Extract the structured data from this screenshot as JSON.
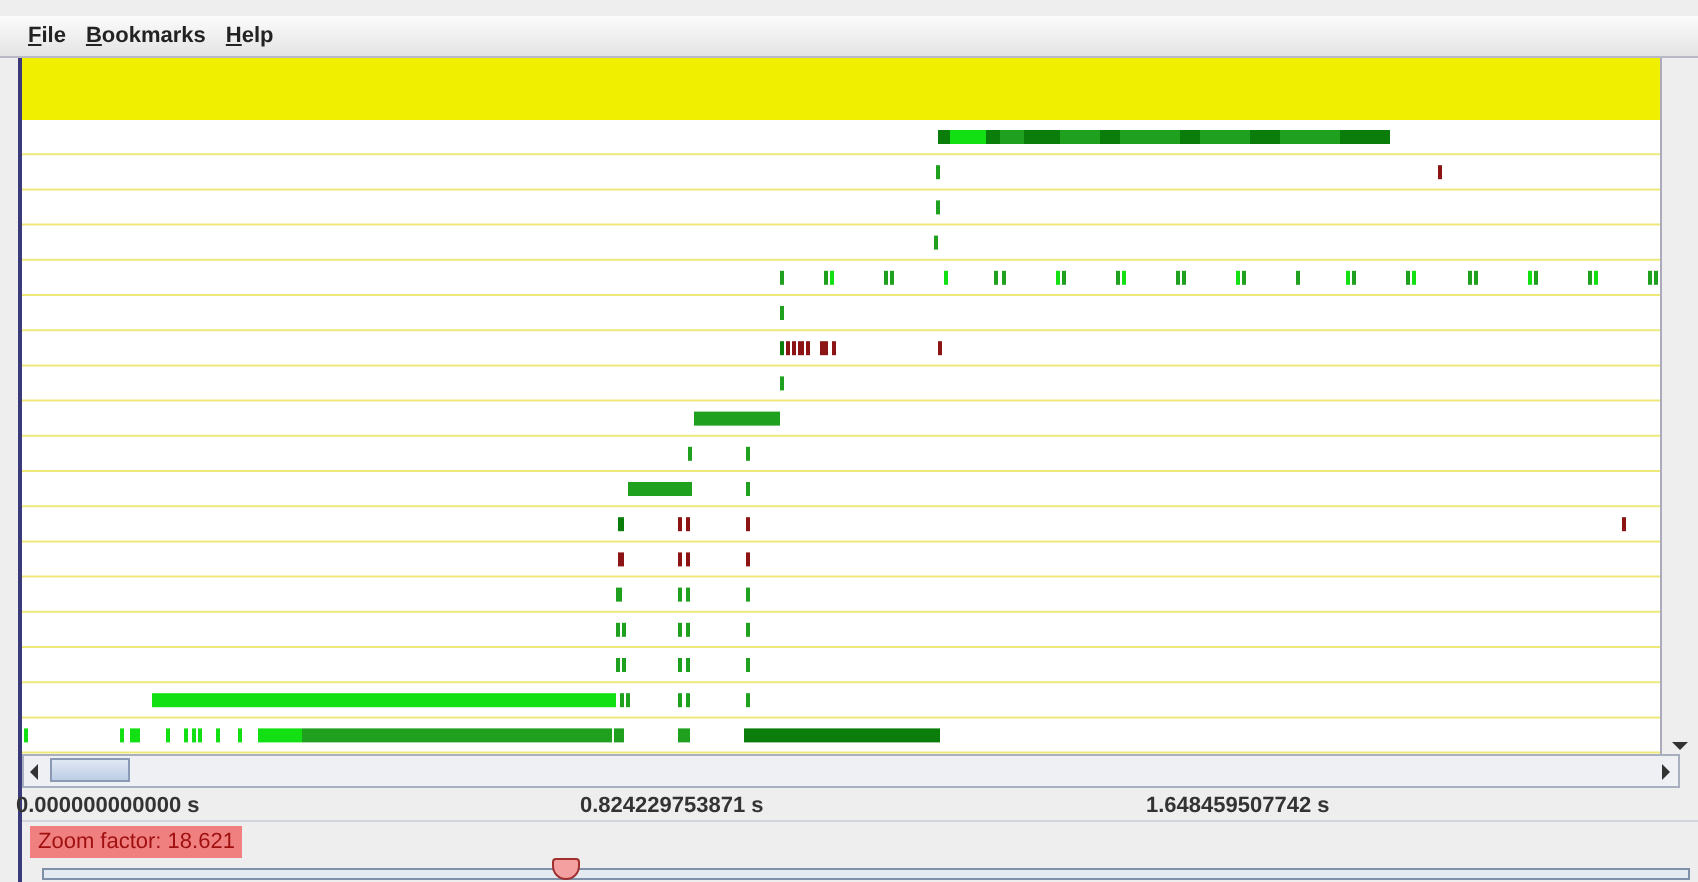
{
  "menu": [
    {
      "label": "File"
    },
    {
      "label": "Bookmarks"
    },
    {
      "label": "Help"
    }
  ],
  "axis_labels": [
    "0.000000000000 s",
    "0.824229753871 s",
    "1.648459507742 s"
  ],
  "zoom": {
    "label": "Zoom factor: 18.621",
    "level": 0.318
  }
}
